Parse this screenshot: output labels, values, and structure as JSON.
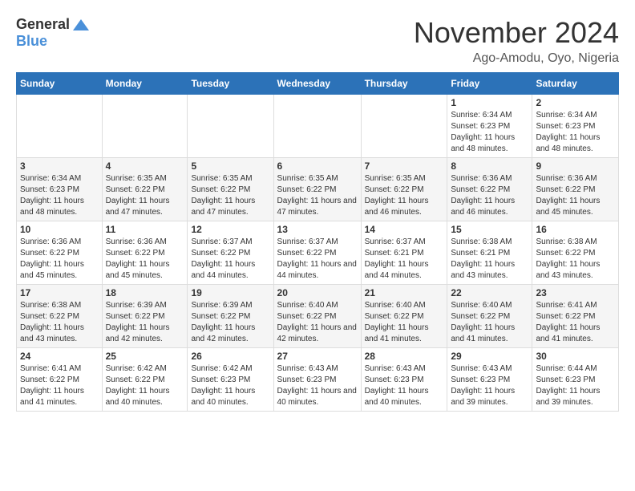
{
  "logo": {
    "general": "General",
    "blue": "Blue"
  },
  "title": "November 2024",
  "location": "Ago-Amodu, Oyo, Nigeria",
  "days_header": [
    "Sunday",
    "Monday",
    "Tuesday",
    "Wednesday",
    "Thursday",
    "Friday",
    "Saturday"
  ],
  "weeks": [
    [
      {
        "day": "",
        "content": ""
      },
      {
        "day": "",
        "content": ""
      },
      {
        "day": "",
        "content": ""
      },
      {
        "day": "",
        "content": ""
      },
      {
        "day": "",
        "content": ""
      },
      {
        "day": "1",
        "content": "Sunrise: 6:34 AM\nSunset: 6:23 PM\nDaylight: 11 hours and 48 minutes."
      },
      {
        "day": "2",
        "content": "Sunrise: 6:34 AM\nSunset: 6:23 PM\nDaylight: 11 hours and 48 minutes."
      }
    ],
    [
      {
        "day": "3",
        "content": "Sunrise: 6:34 AM\nSunset: 6:23 PM\nDaylight: 11 hours and 48 minutes."
      },
      {
        "day": "4",
        "content": "Sunrise: 6:35 AM\nSunset: 6:22 PM\nDaylight: 11 hours and 47 minutes."
      },
      {
        "day": "5",
        "content": "Sunrise: 6:35 AM\nSunset: 6:22 PM\nDaylight: 11 hours and 47 minutes."
      },
      {
        "day": "6",
        "content": "Sunrise: 6:35 AM\nSunset: 6:22 PM\nDaylight: 11 hours and 47 minutes."
      },
      {
        "day": "7",
        "content": "Sunrise: 6:35 AM\nSunset: 6:22 PM\nDaylight: 11 hours and 46 minutes."
      },
      {
        "day": "8",
        "content": "Sunrise: 6:36 AM\nSunset: 6:22 PM\nDaylight: 11 hours and 46 minutes."
      },
      {
        "day": "9",
        "content": "Sunrise: 6:36 AM\nSunset: 6:22 PM\nDaylight: 11 hours and 45 minutes."
      }
    ],
    [
      {
        "day": "10",
        "content": "Sunrise: 6:36 AM\nSunset: 6:22 PM\nDaylight: 11 hours and 45 minutes."
      },
      {
        "day": "11",
        "content": "Sunrise: 6:36 AM\nSunset: 6:22 PM\nDaylight: 11 hours and 45 minutes."
      },
      {
        "day": "12",
        "content": "Sunrise: 6:37 AM\nSunset: 6:22 PM\nDaylight: 11 hours and 44 minutes."
      },
      {
        "day": "13",
        "content": "Sunrise: 6:37 AM\nSunset: 6:22 PM\nDaylight: 11 hours and 44 minutes."
      },
      {
        "day": "14",
        "content": "Sunrise: 6:37 AM\nSunset: 6:21 PM\nDaylight: 11 hours and 44 minutes."
      },
      {
        "day": "15",
        "content": "Sunrise: 6:38 AM\nSunset: 6:21 PM\nDaylight: 11 hours and 43 minutes."
      },
      {
        "day": "16",
        "content": "Sunrise: 6:38 AM\nSunset: 6:22 PM\nDaylight: 11 hours and 43 minutes."
      }
    ],
    [
      {
        "day": "17",
        "content": "Sunrise: 6:38 AM\nSunset: 6:22 PM\nDaylight: 11 hours and 43 minutes."
      },
      {
        "day": "18",
        "content": "Sunrise: 6:39 AM\nSunset: 6:22 PM\nDaylight: 11 hours and 42 minutes."
      },
      {
        "day": "19",
        "content": "Sunrise: 6:39 AM\nSunset: 6:22 PM\nDaylight: 11 hours and 42 minutes."
      },
      {
        "day": "20",
        "content": "Sunrise: 6:40 AM\nSunset: 6:22 PM\nDaylight: 11 hours and 42 minutes."
      },
      {
        "day": "21",
        "content": "Sunrise: 6:40 AM\nSunset: 6:22 PM\nDaylight: 11 hours and 41 minutes."
      },
      {
        "day": "22",
        "content": "Sunrise: 6:40 AM\nSunset: 6:22 PM\nDaylight: 11 hours and 41 minutes."
      },
      {
        "day": "23",
        "content": "Sunrise: 6:41 AM\nSunset: 6:22 PM\nDaylight: 11 hours and 41 minutes."
      }
    ],
    [
      {
        "day": "24",
        "content": "Sunrise: 6:41 AM\nSunset: 6:22 PM\nDaylight: 11 hours and 41 minutes."
      },
      {
        "day": "25",
        "content": "Sunrise: 6:42 AM\nSunset: 6:22 PM\nDaylight: 11 hours and 40 minutes."
      },
      {
        "day": "26",
        "content": "Sunrise: 6:42 AM\nSunset: 6:23 PM\nDaylight: 11 hours and 40 minutes."
      },
      {
        "day": "27",
        "content": "Sunrise: 6:43 AM\nSunset: 6:23 PM\nDaylight: 11 hours and 40 minutes."
      },
      {
        "day": "28",
        "content": "Sunrise: 6:43 AM\nSunset: 6:23 PM\nDaylight: 11 hours and 40 minutes."
      },
      {
        "day": "29",
        "content": "Sunrise: 6:43 AM\nSunset: 6:23 PM\nDaylight: 11 hours and 39 minutes."
      },
      {
        "day": "30",
        "content": "Sunrise: 6:44 AM\nSunset: 6:23 PM\nDaylight: 11 hours and 39 minutes."
      }
    ]
  ]
}
